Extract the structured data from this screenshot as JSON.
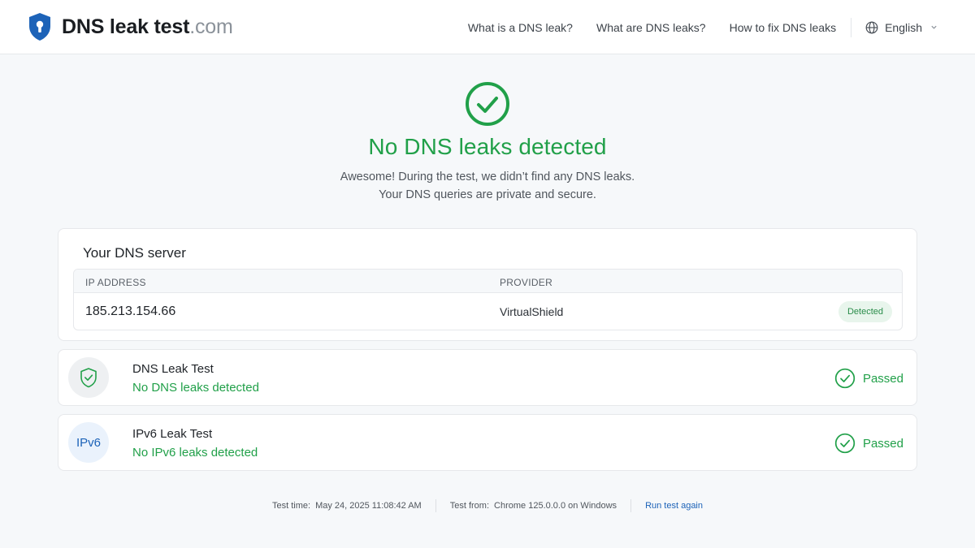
{
  "brand": {
    "name": "DNS leak test",
    "tld": ".com"
  },
  "nav": {
    "items": [
      "What is a DNS leak?",
      "What are DNS leaks?",
      "How to fix DNS leaks"
    ],
    "language": "English"
  },
  "hero": {
    "title": "No DNS leaks detected",
    "line1": "Awesome! During the test, we didn’t find any DNS leaks.",
    "line2": "Your DNS queries are private and secure."
  },
  "server": {
    "title": "Your DNS server",
    "col_ip": "IP ADDRESS",
    "col_provider": "PROVIDER",
    "ip": "185.213.154.66",
    "provider": "VirtualShield",
    "badge": "Detected"
  },
  "tests": [
    {
      "name": "DNS Leak Test",
      "result": "No DNS leaks detected",
      "status": "Passed",
      "icon": "shield-check-icon"
    },
    {
      "name": "IPv6 Leak Test",
      "result": "No IPv6 leaks detected",
      "status": "Passed",
      "icon_text": "IPv6"
    }
  ],
  "footer": {
    "time_label": "Test time:",
    "time_value": "May 24, 2025 11:08:42 AM",
    "from_label": "Test from:",
    "from_value": "Chrome 125.0.0.0 on Windows",
    "rerun": "Run test again"
  },
  "colors": {
    "success": "#21a049",
    "brand_blue": "#1d63b8",
    "background": "#f6f8fa"
  }
}
